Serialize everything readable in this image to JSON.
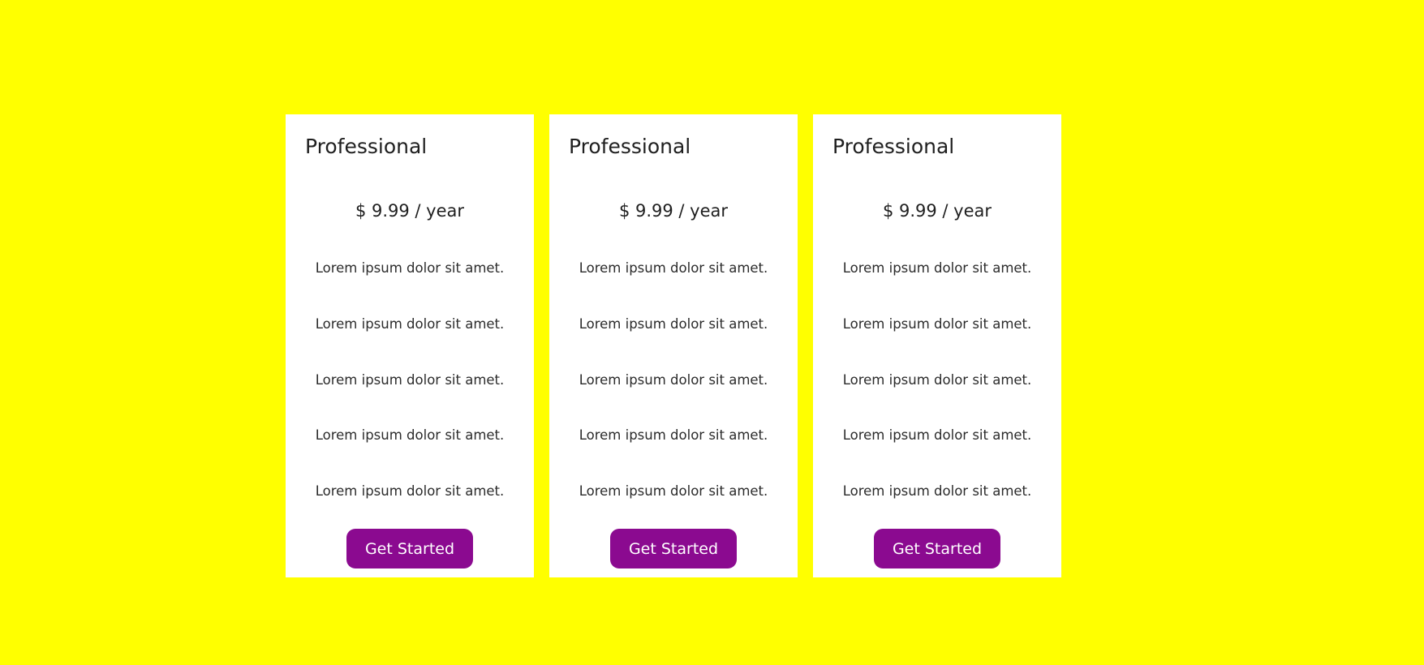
{
  "page": {
    "background_color": "#ffff00",
    "card_color": "#ffffff",
    "button_color": "#8b0a90"
  },
  "plans": [
    {
      "title": "Professional",
      "price": "$ 9.99 / year",
      "features": [
        "Lorem ipsum dolor sit amet.",
        "Lorem ipsum dolor sit amet.",
        "Lorem ipsum dolor sit amet.",
        "Lorem ipsum dolor sit amet.",
        "Lorem ipsum dolor sit amet."
      ],
      "cta_label": "Get Started"
    },
    {
      "title": "Professional",
      "price": "$ 9.99 / year",
      "features": [
        "Lorem ipsum dolor sit amet.",
        "Lorem ipsum dolor sit amet.",
        "Lorem ipsum dolor sit amet.",
        "Lorem ipsum dolor sit amet.",
        "Lorem ipsum dolor sit amet."
      ],
      "cta_label": "Get Started"
    },
    {
      "title": "Professional",
      "price": "$ 9.99 / year",
      "features": [
        "Lorem ipsum dolor sit amet.",
        "Lorem ipsum dolor sit amet.",
        "Lorem ipsum dolor sit amet.",
        "Lorem ipsum dolor sit amet.",
        "Lorem ipsum dolor sit amet."
      ],
      "cta_label": "Get Started"
    }
  ]
}
